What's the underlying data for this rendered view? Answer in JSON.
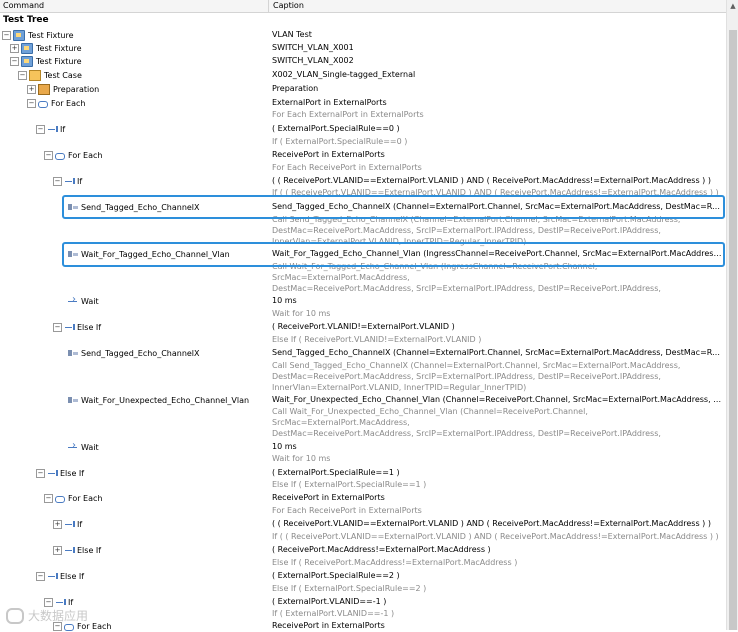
{
  "header": {
    "command": "Command",
    "caption": "Caption"
  },
  "section": "Test Tree",
  "rows": [
    {
      "cmd": "Test Fixture",
      "cap": "VLAN Test",
      "sub": ""
    },
    {
      "cmd": "Test Fixture",
      "cap": "SWITCH_VLAN_X001",
      "sub": ""
    },
    {
      "cmd": "Test Fixture",
      "cap": "SWITCH_VLAN_X002",
      "sub": ""
    },
    {
      "cmd": "Test Case",
      "cap": "X002_VLAN_Single-tagged_External",
      "sub": ""
    },
    {
      "cmd": "Preparation",
      "cap": "Preparation",
      "sub": ""
    },
    {
      "cmd": "For Each",
      "cap": "ExternalPort in ExternalPorts",
      "sub": "For Each ExternalPort in ExternalPorts"
    },
    {
      "cmd": "If",
      "cap": "( ExternalPort.SpecialRule==0 )",
      "sub": "If ( ExternalPort.SpecialRule==0 )"
    },
    {
      "cmd": "For Each",
      "cap": "ReceivePort in ExternalPorts",
      "sub": "For Each ReceivePort in ExternalPorts"
    },
    {
      "cmd": "If",
      "cap": "( ( ReceivePort.VLANID==ExternalPort.VLANID ) AND ( ReceivePort.MacAddress!=ExternalPort.MacAddress ) )",
      "sub": "If ( ( ReceivePort.VLANID==ExternalPort.VLANID ) AND ( ReceivePort.MacAddress!=ExternalPort.MacAddress ) )"
    },
    {
      "cmd": "Send_Tagged_Echo_ChannelX",
      "cap": "Send_Tagged_Echo_ChannelX (Channel=ExternalPort.Channel, SrcMac=ExternalPort.MacAddress, DestMac=Receive...",
      "sub": "Call Send_Tagged_Echo_ChannelX (Channel=ExternalPort.Channel, SrcMac=ExternalPort.MacAddress,\nDestMac=ReceivePort.MacAddress, SrcIP=ExternalPort.IPAddress, DestIP=ReceivePort.IPAddress,\nInnerVlan=ExternalPort.VLANID, InnerTPID=Regular_InnerTPID)"
    },
    {
      "cmd": "Wait_For_Tagged_Echo_Channel_Vlan",
      "cap": "Wait_For_Tagged_Echo_Channel_Vlan (IngressChannel=ReceivePort.Channel, SrcMac=ExternalPort.MacAddress, De...",
      "sub": "Call Wait_For_Tagged_Echo_Channel_Vlan (IngressChannel=ReceivePort.Channel, SrcMac=ExternalPort.MacAddress,\nDestMac=ReceivePort.MacAddress, SrcIP=ExternalPort.IPAddress, DestIP=ReceivePort.IPAddress,\nIngressVlan=ReceivePort.VLANID, InnerTPID=Regular_InnerTPID, timeout=WaitResponseTime)"
    },
    {
      "cmd": "Wait",
      "cap": "10 ms",
      "sub": "Wait for 10 ms"
    },
    {
      "cmd": "Else If",
      "cap": "( ReceivePort.VLANID!=ExternalPort.VLANID )",
      "sub": "Else If ( ReceivePort.VLANID!=ExternalPort.VLANID )"
    },
    {
      "cmd": "Send_Tagged_Echo_ChannelX",
      "cap": "Send_Tagged_Echo_ChannelX (Channel=ExternalPort.Channel, SrcMac=ExternalPort.MacAddress, DestMac=Receive...",
      "sub": "Call Send_Tagged_Echo_ChannelX (Channel=ExternalPort.Channel, SrcMac=ExternalPort.MacAddress,\nDestMac=ReceivePort.MacAddress, SrcIP=ExternalPort.IPAddress, DestIP=ReceivePort.IPAddress,\nInnerVlan=ExternalPort.VLANID, InnerTPID=Regular_InnerTPID)"
    },
    {
      "cmd": "Wait_For_Unexpected_Echo_Channel_Vlan",
      "cap": "Wait_For_Unexpected_Echo_Channel_Vlan (Channel=ReceivePort.Channel, SrcMac=ExternalPort.MacAddress, DestM...",
      "sub": "Call Wait_For_Unexpected_Echo_Channel_Vlan (Channel=ReceivePort.Channel, SrcMac=ExternalPort.MacAddress,\nDestMac=ReceivePort.MacAddress, SrcIP=ExternalPort.IPAddress, DestIP=ReceivePort.IPAddress,\nIngressVlan=ReceivePort.VLANID, InnerTPID=Regular_InnerTPID, timeout=WaitResponseTime)"
    },
    {
      "cmd": "Wait",
      "cap": "10 ms",
      "sub": "Wait for 10 ms"
    },
    {
      "cmd": "Else If",
      "cap": "( ExternalPort.SpecialRule==1 )",
      "sub": "Else If ( ExternalPort.SpecialRule==1 )"
    },
    {
      "cmd": "For Each",
      "cap": "ReceivePort in ExternalPorts",
      "sub": "For Each ReceivePort in ExternalPorts"
    },
    {
      "cmd": "If",
      "cap": "( ( ReceivePort.VLANID==ExternalPort.VLANID ) AND ( ReceivePort.MacAddress!=ExternalPort.MacAddress ) )",
      "sub": "If ( ( ReceivePort.VLANID==ExternalPort.VLANID ) AND ( ReceivePort.MacAddress!=ExternalPort.MacAddress ) )"
    },
    {
      "cmd": "Else If",
      "cap": "( ReceivePort.MacAddress!=ExternalPort.MacAddress )",
      "sub": "Else If ( ReceivePort.MacAddress!=ExternalPort.MacAddress )"
    },
    {
      "cmd": "Else If",
      "cap": "( ExternalPort.SpecialRule==2 )",
      "sub": "Else If ( ExternalPort.SpecialRule==2 )"
    },
    {
      "cmd": "If",
      "cap": "( ExternalPort.VLANID==-1 )",
      "sub": "If ( ExternalPort.VLANID==-1 )"
    },
    {
      "cmd": "For Each",
      "cap": "ReceivePort in ExternalPorts",
      "sub": ""
    }
  ],
  "watermark": "大数据应用",
  "colors": {
    "highlight": "#2d8fdb",
    "subtext": "#8a8a8a"
  }
}
